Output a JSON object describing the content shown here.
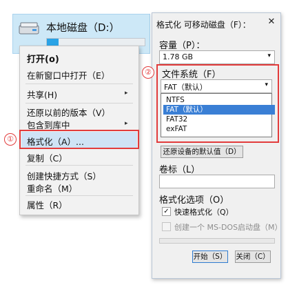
{
  "drive": {
    "name": "本地磁盘（D:）",
    "usage_fraction": 0.12,
    "icon": "drive-icon"
  },
  "context_menu": {
    "open": "打开(o)",
    "open_new_window": "在新窗口中打开（E）",
    "share": "共享(H)",
    "restore_previous": "还原以前的版本（V）",
    "include_in_library": "包含到库中",
    "format": "格式化（A）...",
    "copy": "复制（C）",
    "create_shortcut": "创建快捷方式（S）",
    "rename": "重命名（M）",
    "properties": "属性（R）",
    "submenu_arrow": "▸"
  },
  "annotations": {
    "one": "①",
    "two": "②"
  },
  "dialog": {
    "title": "格式化 可移动磁盘（F）：",
    "close": "✕",
    "capacity_label": "容量（P）：",
    "capacity_value": "1.78 GB",
    "filesystem_label": "文件系统（F）",
    "filesystem_value": "FAT（默认）",
    "filesystem_options": [
      "NTFS",
      "FAT（默认）",
      "FAT32",
      "exFAT"
    ],
    "restore_defaults": "还原设备的默认值（D）",
    "volume_label": "卷标（L）",
    "volume_value": "",
    "format_options_label": "格式化选项（O）",
    "quick_format": "快速格式化（Q）",
    "quick_format_checked": true,
    "msdos_boot": "创建一个 MS-DOS启动盘（M）",
    "msdos_boot_checked": false,
    "start_button": "开始（S）",
    "close_button": "关闭（C）",
    "progress_fraction": 0,
    "dropdown_arrow": "▾",
    "checkmark": "✓"
  }
}
